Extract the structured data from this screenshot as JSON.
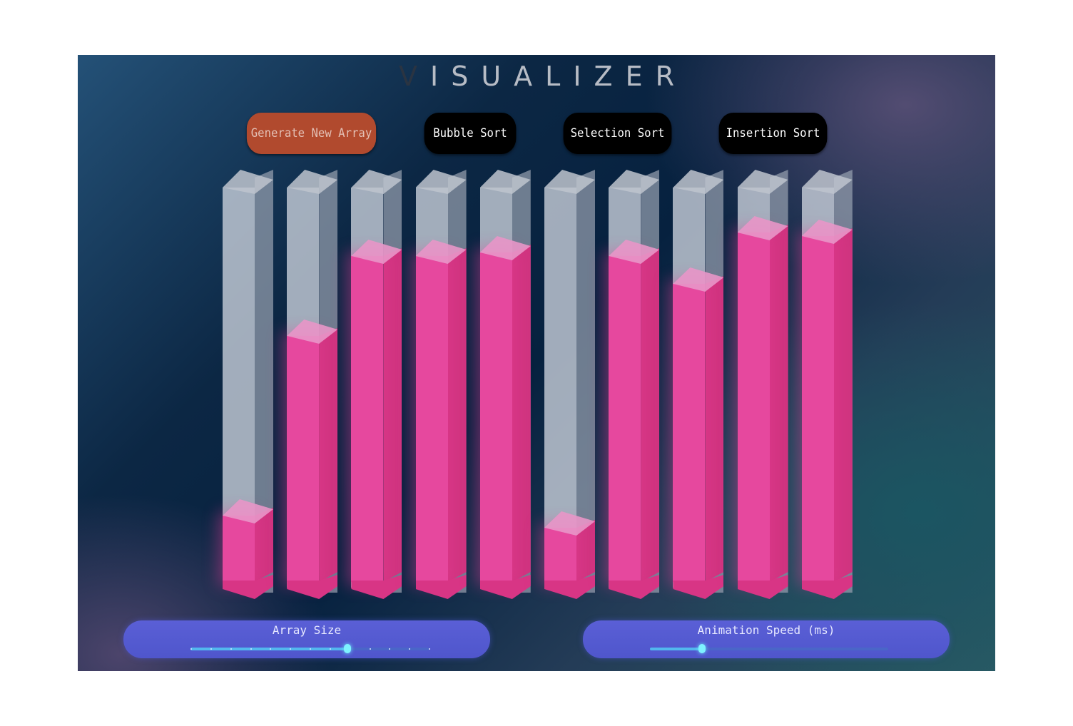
{
  "title": {
    "first_letter": "V",
    "rest": "ISUALIZER"
  },
  "buttons": {
    "generate": "Generate New Array",
    "bubble": "Bubble Sort",
    "selection": "Selection Sort",
    "insertion": "Insertion Sort"
  },
  "array": {
    "fill_fractions": [
      0.18,
      0.63,
      0.83,
      0.83,
      0.84,
      0.15,
      0.83,
      0.76,
      0.89,
      0.88
    ],
    "bar_color": "#e6489e"
  },
  "controls": {
    "array_size_label": "Array Size",
    "array_size_level": 0.66,
    "array_size_ticks": 13,
    "speed_label": "Animation Speed (ms)",
    "speed_level": 0.22
  },
  "colors": {
    "accent": "#b14a2e",
    "panel": "#5a5fd6",
    "thumb": "#7ef2ff"
  }
}
